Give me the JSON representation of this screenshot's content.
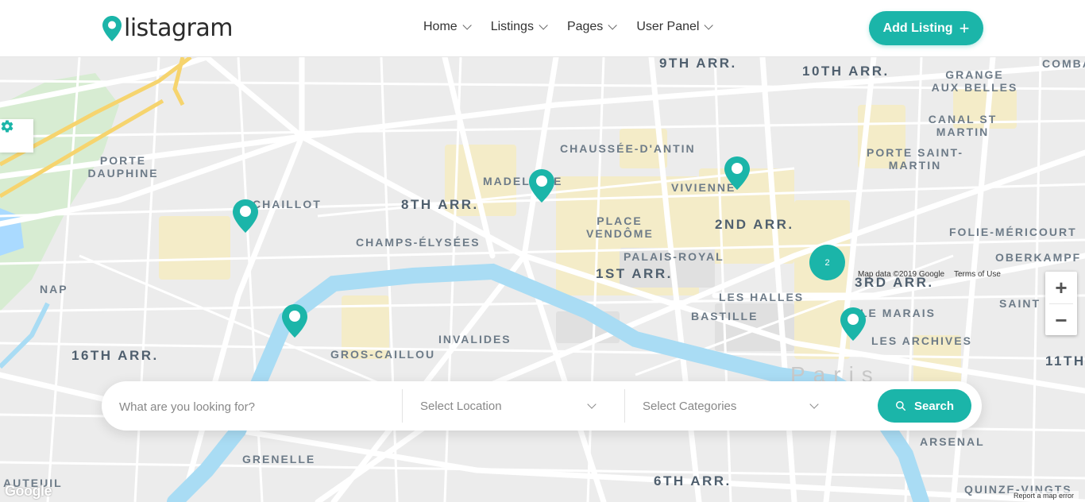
{
  "brand": {
    "name": "listagram",
    "accent": "#1bb5a9"
  },
  "nav": [
    {
      "label": "Home"
    },
    {
      "label": "Listings"
    },
    {
      "label": "Pages"
    },
    {
      "label": "User Panel"
    }
  ],
  "header": {
    "add_listing_label": "Add Listing"
  },
  "map": {
    "districts": [
      "9TH ARR.",
      "10TH ARR.",
      "8TH ARR.",
      "2ND ARR.",
      "1ST ARR.",
      "3RD ARR.",
      "16TH ARR.",
      "6TH ARR.",
      "11TH"
    ],
    "quarters": [
      "PORTE DAUPHINE",
      "CHAILLOT",
      "CHAMPS-ÉLYSÉES",
      "MADELEINE",
      "CHAUSSÉE-D'ANTIN",
      "VIVIENNE",
      "PLACE VENDÔME",
      "PALAIS-ROYAL",
      "LES HALLES",
      "BASTILLE",
      "LE MARAIS",
      "LES ARCHIVES",
      "INVALIDES",
      "GROS-CAILLOU",
      "GRENELLE",
      "ARSENAL",
      "GRANGE AUX BELLES",
      "CANAL ST MARTIN",
      "PORTE SAINT-MARTIN",
      "FOLIE-MÉRICOURT",
      "OBERKAMPF",
      "NAP",
      "COMBA",
      "SAINT",
      "AUTEUIL",
      "QUINZE-VINGTS"
    ],
    "city_label": "Paris",
    "cluster_count": "2",
    "map_data": "Map data ©2019 Google",
    "terms": "Terms of Use",
    "google": "Google",
    "report": "Report a map error",
    "zoom_in": "+",
    "zoom_out": "−"
  },
  "search": {
    "placeholder": "What are you looking for?",
    "location_label": "Select Location",
    "categories_label": "Select Categories",
    "button_label": "Search"
  }
}
